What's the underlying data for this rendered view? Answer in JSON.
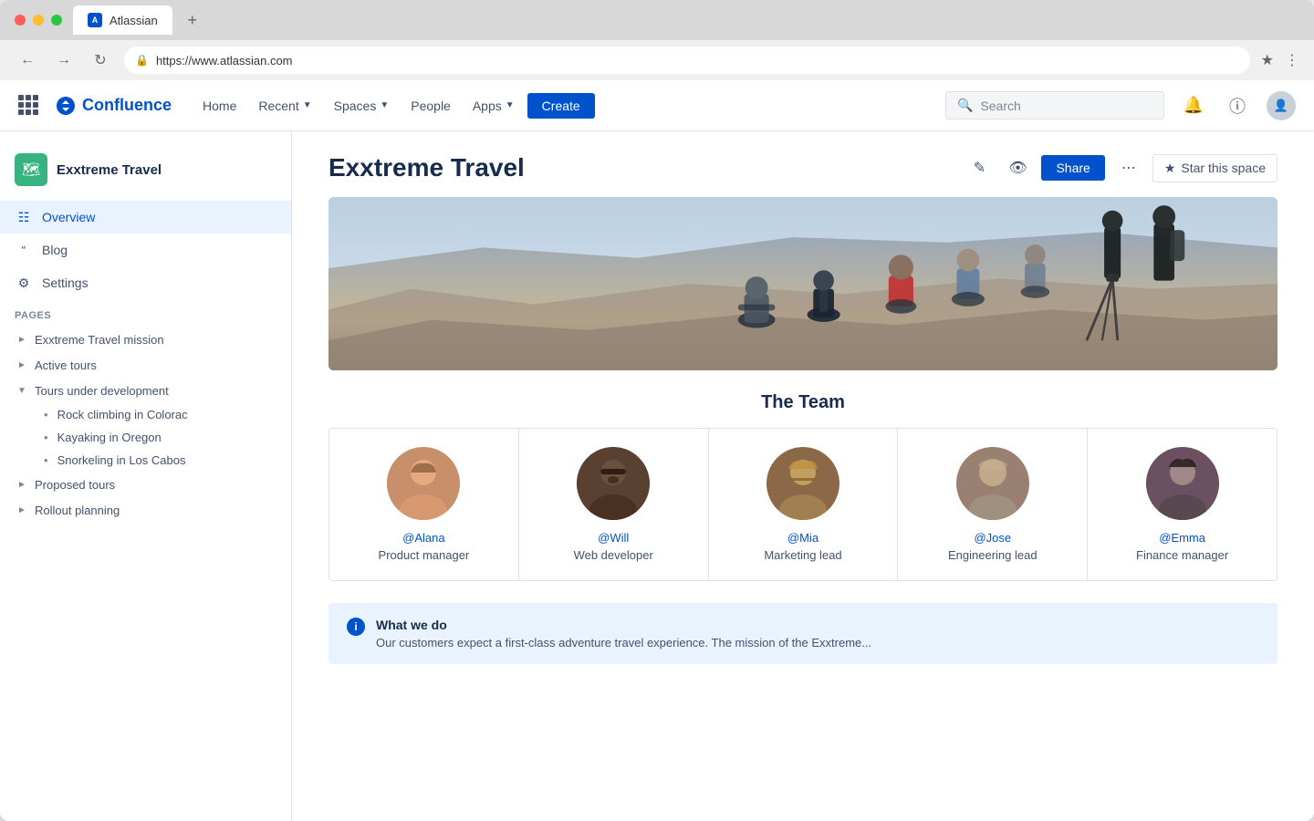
{
  "browser": {
    "tab_title": "Atlassian",
    "url": "https://www.atlassian.com",
    "new_tab_label": "+"
  },
  "nav": {
    "app_grid_label": "App switcher",
    "logo_text": "Confluence",
    "home": "Home",
    "recent": "Recent",
    "spaces": "Spaces",
    "people": "People",
    "apps": "Apps",
    "create": "Create",
    "search_placeholder": "Search",
    "notifications_label": "Notifications",
    "help_label": "Help",
    "profile_label": "Profile"
  },
  "sidebar": {
    "space_name": "Exxtreme Travel",
    "overview": "Overview",
    "blog": "Blog",
    "settings": "Settings",
    "pages_label": "PAGES",
    "pages": [
      {
        "label": "Exxtreme Travel mission",
        "expanded": false,
        "level": 0
      },
      {
        "label": "Active tours",
        "expanded": false,
        "level": 0
      },
      {
        "label": "Tours under development",
        "expanded": true,
        "level": 0
      },
      {
        "label": "Rock climbing in Colorac",
        "level": 1
      },
      {
        "label": "Kayaking in Oregon",
        "level": 1
      },
      {
        "label": "Snorkeling in Los Cabos",
        "level": 1
      },
      {
        "label": "Proposed tours",
        "expanded": false,
        "level": 0
      },
      {
        "label": "Rollout planning",
        "expanded": false,
        "level": 0
      }
    ]
  },
  "page": {
    "title": "Exxtreme Travel",
    "share_label": "Share",
    "star_label": "Star this space",
    "more_label": "More actions"
  },
  "team": {
    "title": "The Team",
    "members": [
      {
        "handle": "@Alana",
        "role": "Product manager",
        "emoji": "👩"
      },
      {
        "handle": "@Will",
        "role": "Web developer",
        "emoji": "👨"
      },
      {
        "handle": "@Mia",
        "role": "Marketing lead",
        "emoji": "👩"
      },
      {
        "handle": "@Jose",
        "role": "Engineering lead",
        "emoji": "👨"
      },
      {
        "handle": "@Emma",
        "role": "Finance manager",
        "emoji": "👩"
      }
    ]
  },
  "info_box": {
    "icon": "i",
    "title": "What we do",
    "text": "Our customers expect a first-class adventure travel experience. The mission of the Exxtreme..."
  }
}
